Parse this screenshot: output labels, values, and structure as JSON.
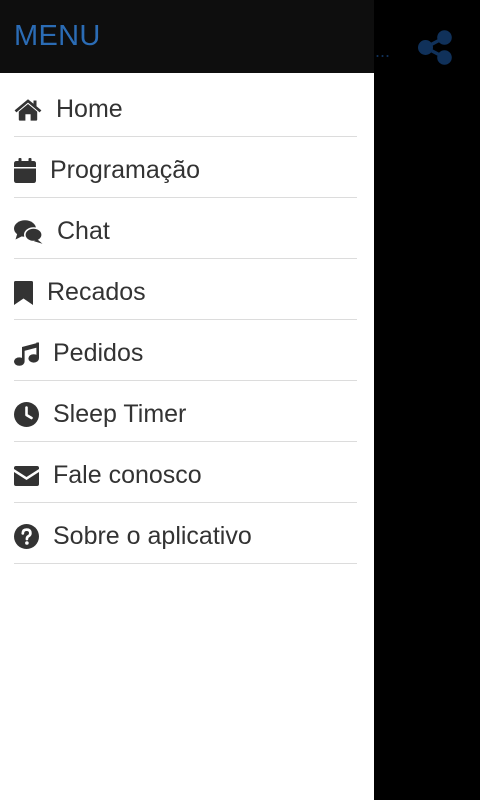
{
  "colors": {
    "accent": "#2b6cb5",
    "header_bg": "#0e0e0e",
    "scrim": "#000000",
    "drawer_bg": "#ffffff",
    "text": "#333333",
    "divider": "#dcdcdc",
    "dimmed_accent": "#10315a"
  },
  "backdrop": {
    "title_fragment": "...",
    "share_icon": "share-icon"
  },
  "drawer": {
    "header": {
      "title": "MENU"
    },
    "items": [
      {
        "label": "Home",
        "icon": "home-icon"
      },
      {
        "label": "Programação",
        "icon": "calendar-icon"
      },
      {
        "label": "Chat",
        "icon": "comments-icon"
      },
      {
        "label": "Recados",
        "icon": "bookmark-icon"
      },
      {
        "label": "Pedidos",
        "icon": "music-icon"
      },
      {
        "label": "Sleep Timer",
        "icon": "clock-icon"
      },
      {
        "label": "Fale conosco",
        "icon": "envelope-icon"
      },
      {
        "label": "Sobre o aplicativo",
        "icon": "question-circle-icon"
      }
    ]
  }
}
